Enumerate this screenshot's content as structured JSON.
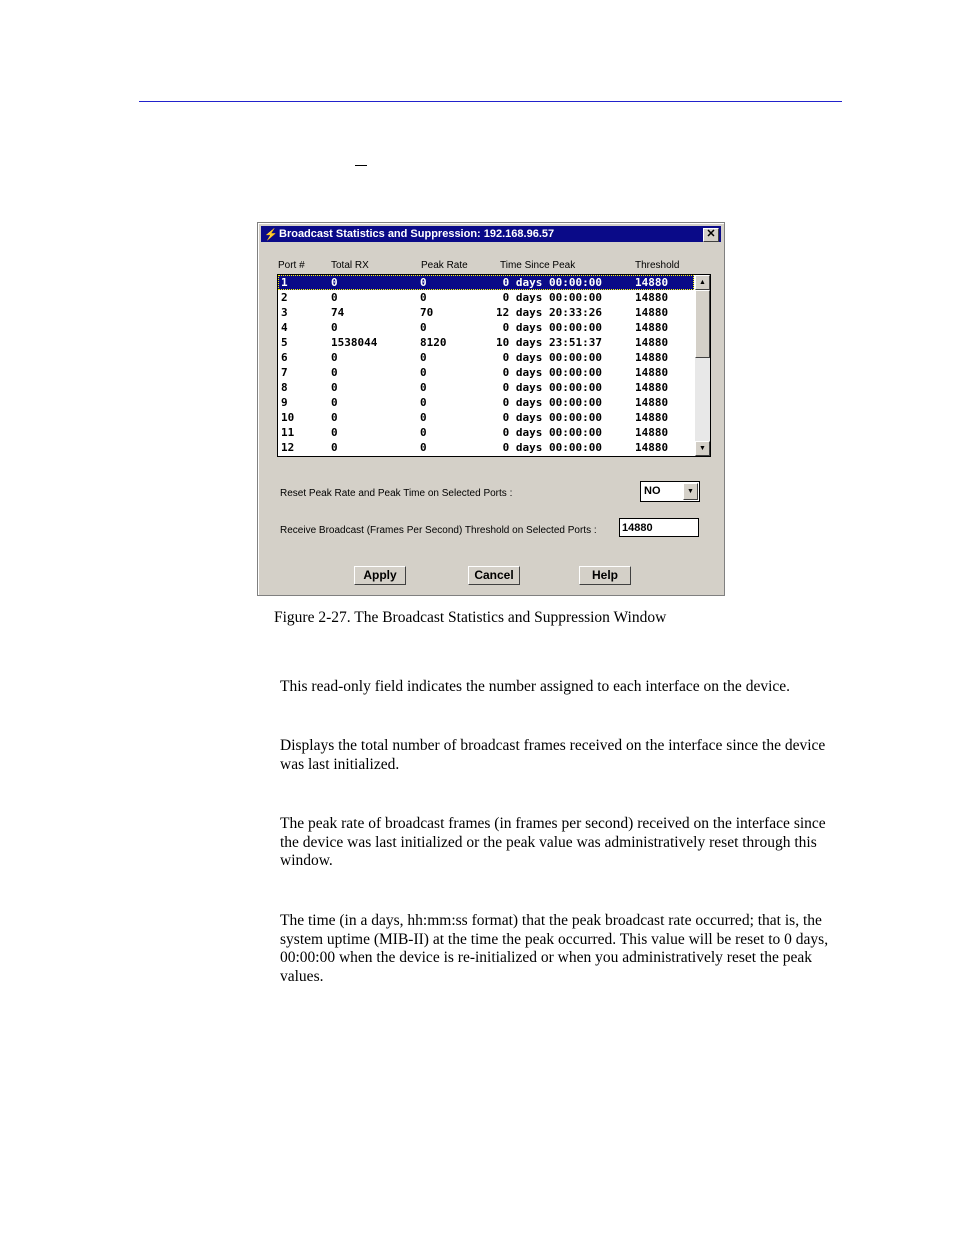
{
  "dialog": {
    "title": "Broadcast Statistics and Suppression: 192.168.96.57",
    "columns": [
      "Port #",
      "Total RX",
      "Peak Rate",
      "Time Since Peak",
      "Threshold"
    ],
    "rows": [
      [
        "1",
        "0",
        "0",
        " 0 days 00:00:00",
        "14880"
      ],
      [
        "2",
        "0",
        "0",
        " 0 days 00:00:00",
        "14880"
      ],
      [
        "3",
        "74",
        "70",
        "12 days 20:33:26",
        "14880"
      ],
      [
        "4",
        "0",
        "0",
        " 0 days 00:00:00",
        "14880"
      ],
      [
        "5",
        "1538044",
        "8120",
        "10 days 23:51:37",
        "14880"
      ],
      [
        "6",
        "0",
        "0",
        " 0 days 00:00:00",
        "14880"
      ],
      [
        "7",
        "0",
        "0",
        " 0 days 00:00:00",
        "14880"
      ],
      [
        "8",
        "0",
        "0",
        " 0 days 00:00:00",
        "14880"
      ],
      [
        "9",
        "0",
        "0",
        " 0 days 00:00:00",
        "14880"
      ],
      [
        "10",
        "0",
        "0",
        " 0 days 00:00:00",
        "14880"
      ],
      [
        "11",
        "0",
        "0",
        " 0 days 00:00:00",
        "14880"
      ],
      [
        "12",
        "0",
        "0",
        " 0 days 00:00:00",
        "14880"
      ]
    ],
    "selected_row": 0,
    "reset_label": "Reset Peak Rate and Peak Time on Selected Ports :",
    "reset_value": "NO",
    "threshold_label": "Receive Broadcast (Frames Per Second) Threshold on Selected Ports :",
    "threshold_value": "14880",
    "buttons": {
      "apply": "Apply",
      "cancel": "Cancel",
      "help": "Help"
    }
  },
  "caption": "Figure 2-27.  The Broadcast Statistics and Suppression Window",
  "paragraphs": [
    "This read-only field indicates the number assigned to each interface on the device.",
    "Displays the total number of broadcast frames received on the interface since the device was last initialized.",
    "The peak rate of broadcast frames (in frames per second) received on the interface since the device was last initialized or the peak value was administratively reset through this window.",
    "The time (in a days, hh:mm:ss format) that the peak broadcast rate occurred; that is, the system uptime (MIB-II) at the time the peak occurred. This value will be reset to 0 days, 00:00:00 when the device is re-initialized or when you administratively reset the peak values."
  ]
}
